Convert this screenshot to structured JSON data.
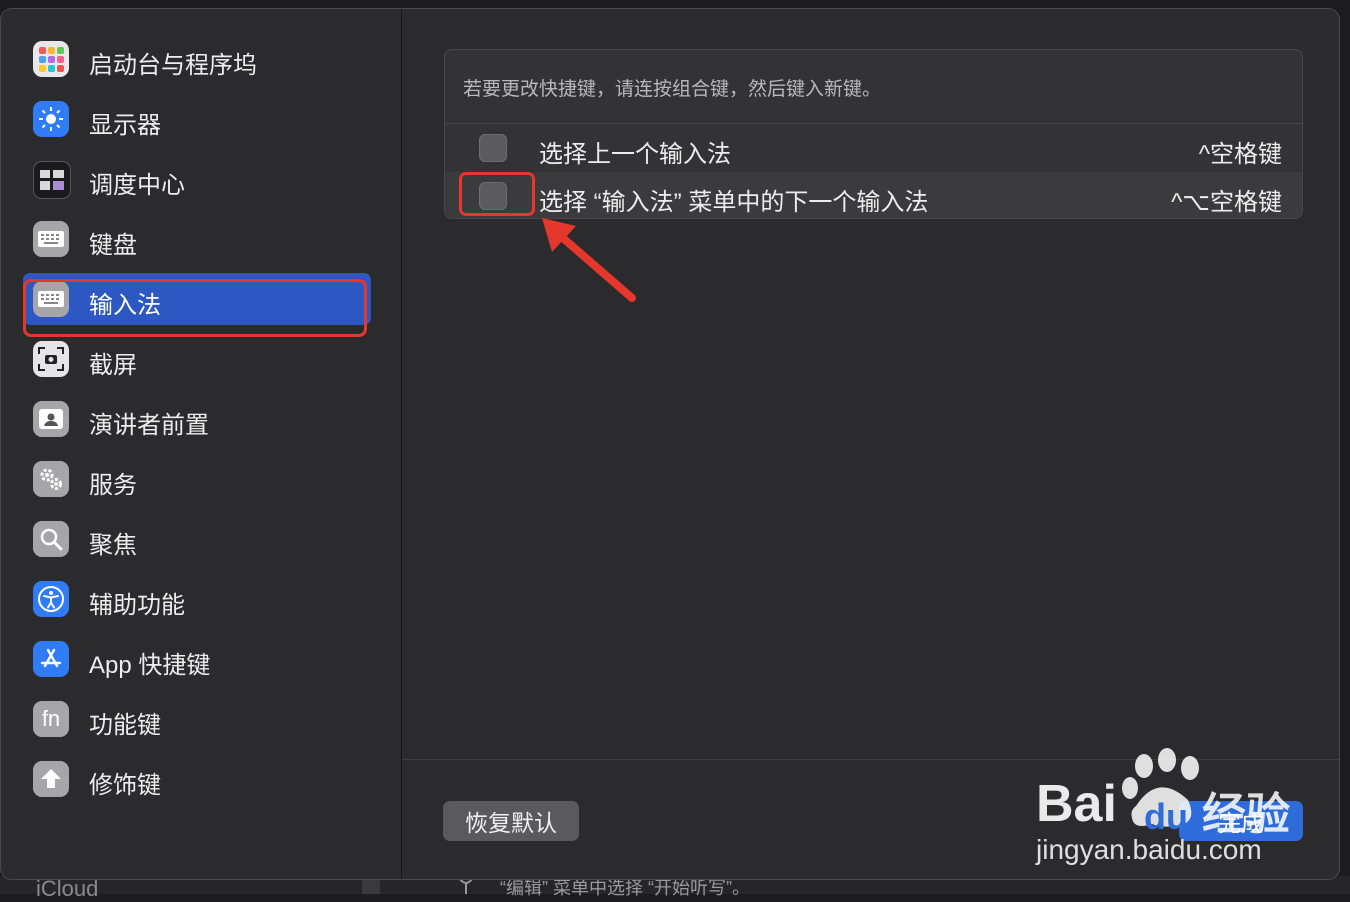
{
  "sidebar": {
    "items": [
      {
        "label": "启动台与程序坞",
        "icon": "launchpad-icon",
        "color": "#e8e8ea"
      },
      {
        "label": "显示器",
        "icon": "display-sun-icon",
        "color": "#2f7cf6"
      },
      {
        "label": "调度中心",
        "icon": "mission-control-icon",
        "color": "#1b1b1d"
      },
      {
        "label": "键盘",
        "icon": "keyboard-icon",
        "color": "#a6a6aa"
      },
      {
        "label": "输入法",
        "icon": "keyboard-icon",
        "color": "#a6a6aa",
        "selected": true
      },
      {
        "label": "截屏",
        "icon": "screenshot-icon",
        "color": "#d8d8da"
      },
      {
        "label": "演讲者前置",
        "icon": "presenter-icon",
        "color": "#a6a6aa"
      },
      {
        "label": "服务",
        "icon": "gears-icon",
        "color": "#a6a6aa"
      },
      {
        "label": "聚焦",
        "icon": "spotlight-icon",
        "color": "#a6a6aa"
      },
      {
        "label": "辅助功能",
        "icon": "accessibility-icon",
        "color": "#2f7cf6"
      },
      {
        "label": "App 快捷键",
        "icon": "app-store-icon",
        "color": "#2f7cf6"
      },
      {
        "label": "功能键",
        "icon": "fn-key-icon",
        "color": "#a6a6aa",
        "icon_text": "fn"
      },
      {
        "label": "修饰键",
        "icon": "modifier-arrow-icon",
        "color": "#a6a6aa"
      }
    ]
  },
  "main": {
    "hint": "若要更改快捷键，请连按组合键，然后键入新键。",
    "shortcuts": [
      {
        "label": "选择上一个输入法",
        "keys": "^空格键",
        "checked": false
      },
      {
        "label": "选择 “输入法” 菜单中的下一个输入法",
        "keys": "^⌥空格键",
        "checked": false
      }
    ]
  },
  "footer": {
    "restore_label": "恢复默认",
    "done_label": "完成"
  },
  "background": {
    "sidebar_peek": "iCloud",
    "hint_peek": "“编辑” 菜单中选择 “开始听写”。"
  },
  "watermark": {
    "brand": "Bai",
    "brand2": "du",
    "brand_cn": "经验",
    "url": "jingyan.baidu.com"
  },
  "colors": {
    "accent": "#2f6cdb",
    "selection": "#2d57c2",
    "annotation_red": "#e5372c"
  }
}
